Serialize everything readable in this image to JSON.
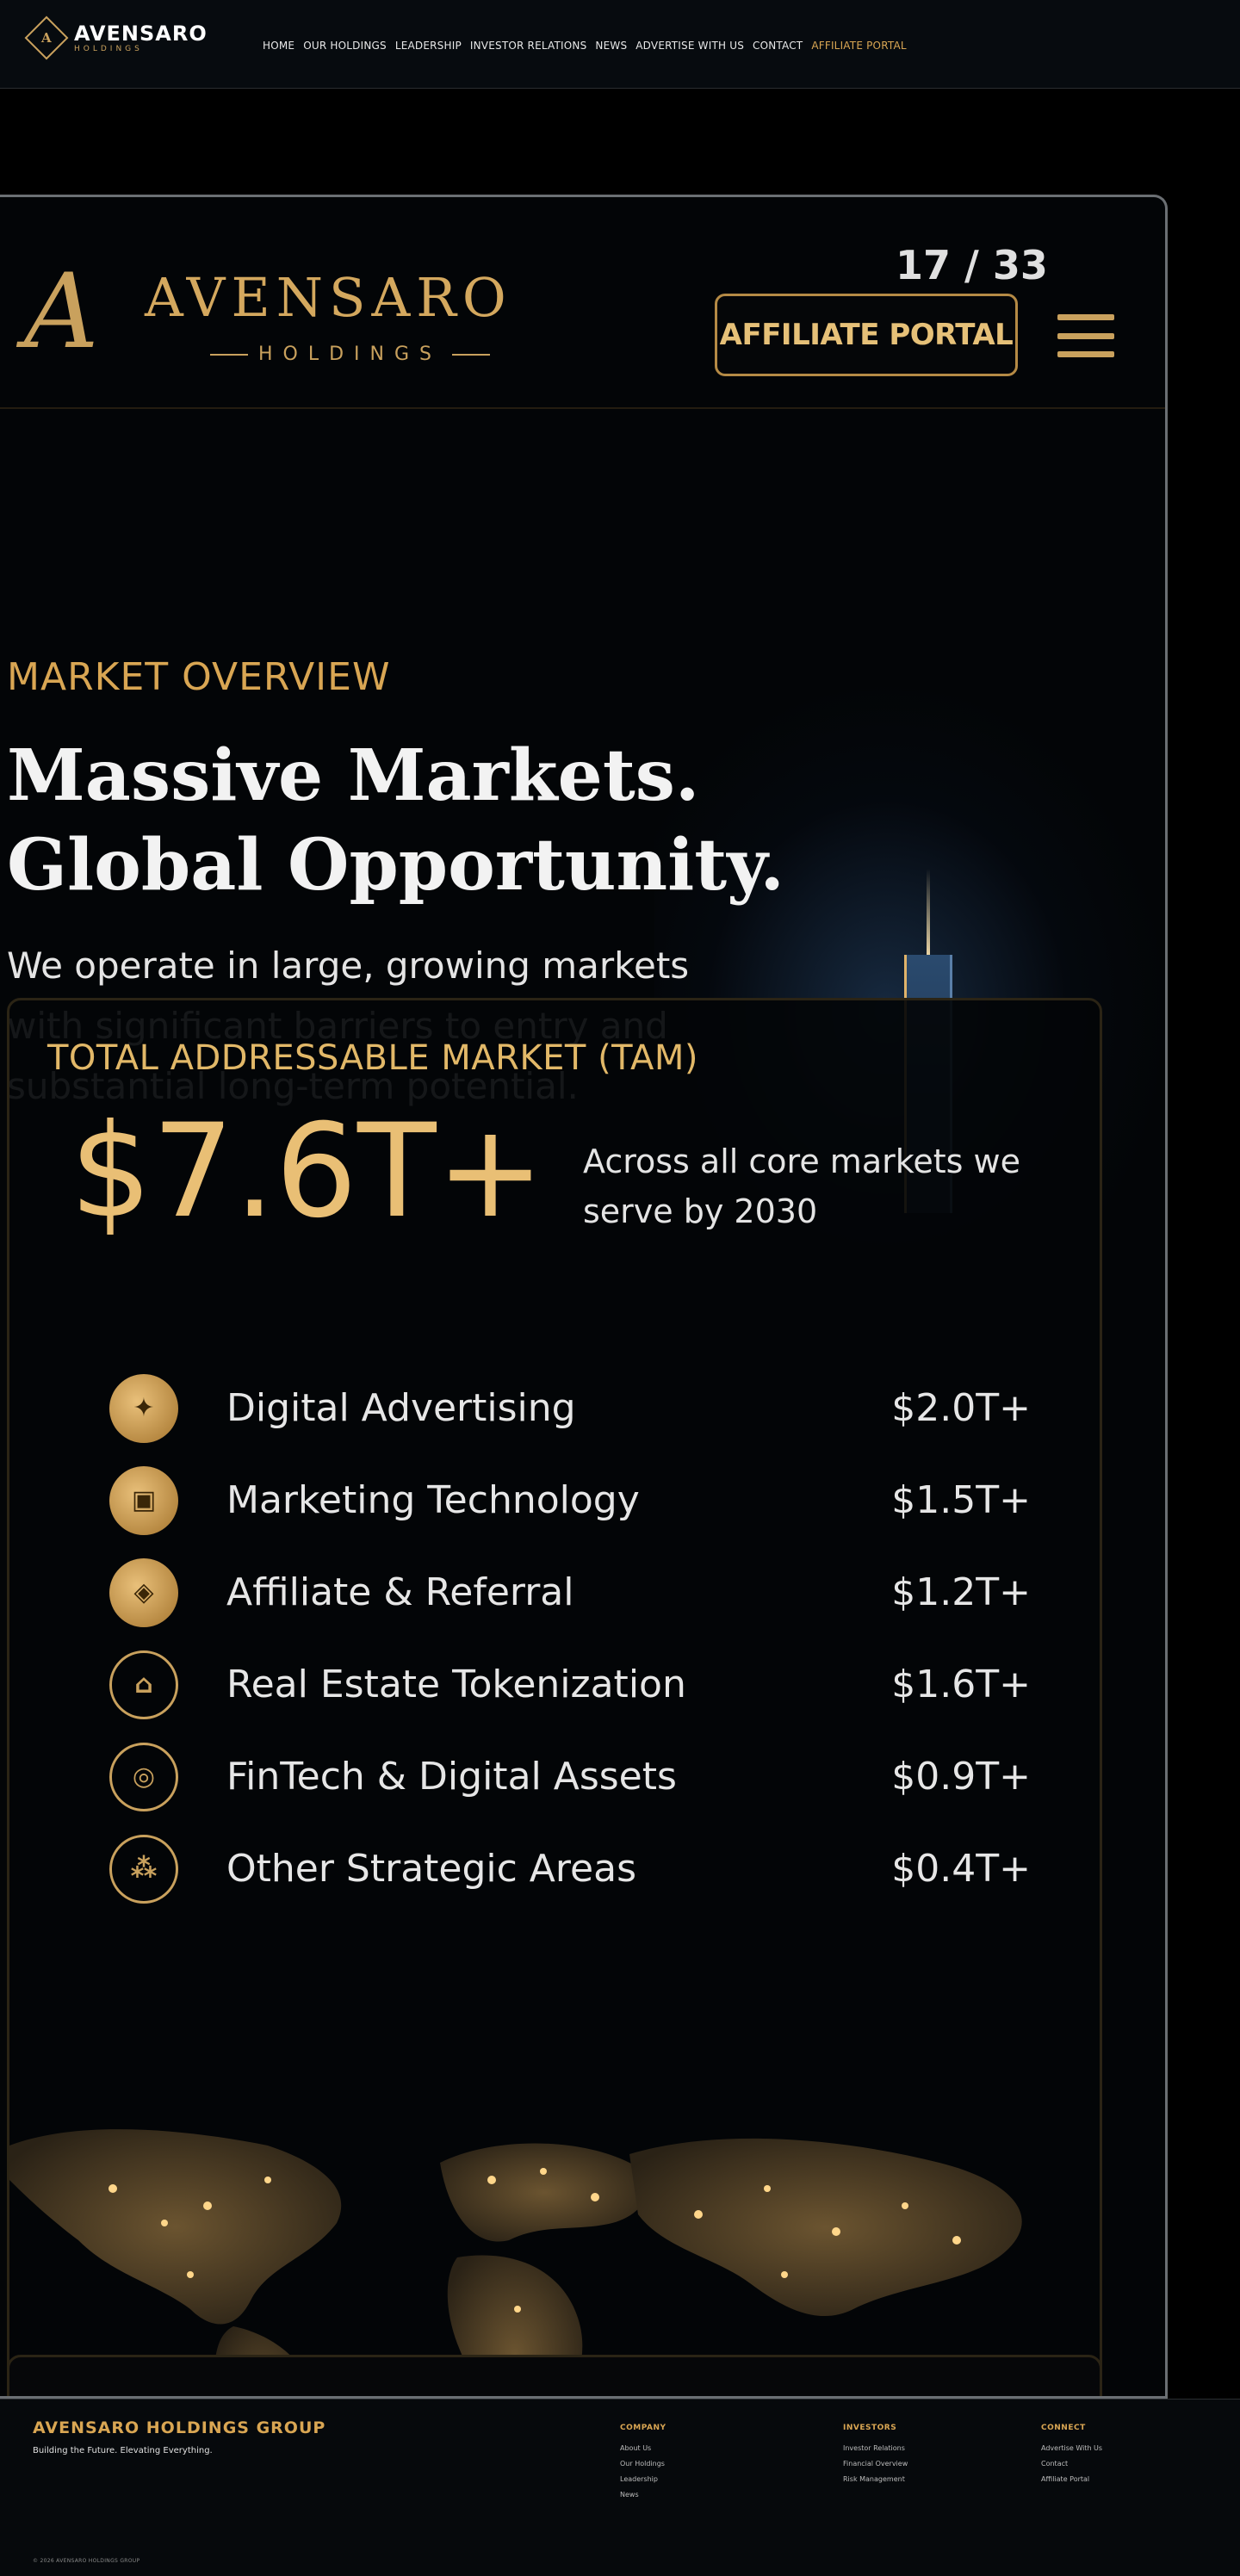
{
  "site": {
    "logo_letter": "A",
    "logo_name": "AVENSARO",
    "logo_sub": "HOLDINGS",
    "nav": [
      {
        "label": "HOME"
      },
      {
        "label": "OUR HOLDINGS"
      },
      {
        "label": "LEADERSHIP"
      },
      {
        "label": "INVESTOR RELATIONS"
      },
      {
        "label": "NEWS"
      },
      {
        "label": "ADVERTISE WITH US"
      },
      {
        "label": "CONTACT"
      },
      {
        "label": "AFFILIATE PORTAL"
      }
    ],
    "accent_color": "#d9a653"
  },
  "slide": {
    "brand_letter": "A",
    "brand_name": "AVENSARO",
    "brand_sub": "HOLDINGS",
    "page_count": "17 / 33",
    "portal_button": "AFFILIATE PORTAL",
    "eyebrow": "MARKET OVERVIEW",
    "headline_1": "Massive Markets.",
    "headline_2": "Global Opportunity.",
    "intro": "We operate in large, growing markets with significant barriers to entry and substantial long-term potential.",
    "tam": {
      "label": "TOTAL ADDRESSABLE MARKET (TAM)",
      "value": "$7.6T+",
      "description": "Across all core markets we serve by 2030"
    },
    "markets": [
      {
        "name": "Digital Advertising",
        "value": "$2.0T+",
        "icon": "badge-icon"
      },
      {
        "name": "Marketing Technology",
        "value": "$1.5T+",
        "icon": "chip-icon"
      },
      {
        "name": "Affiliate & Referral",
        "value": "$1.2T+",
        "icon": "handshake-icon"
      },
      {
        "name": "Real Estate Tokenization",
        "value": "$1.6T+",
        "icon": "building-icon"
      },
      {
        "name": "FinTech & Digital Assets",
        "value": "$0.9T+",
        "icon": "coin-icon"
      },
      {
        "name": "Other Strategic Areas",
        "value": "$0.4T+",
        "icon": "network-icon"
      }
    ]
  },
  "footer": {
    "brand": "AVENSARO HOLDINGS GROUP",
    "tagline": "Building the Future. Elevating Everything.",
    "columns": [
      {
        "title": "COMPANY",
        "links": [
          "About Us",
          "Our Holdings",
          "Leadership",
          "News"
        ]
      },
      {
        "title": "INVESTORS",
        "links": [
          "Investor Relations",
          "Financial Overview",
          "Risk Management"
        ]
      },
      {
        "title": "CONNECT",
        "links": [
          "Advertise With Us",
          "Contact",
          "Affiliate Portal"
        ]
      }
    ],
    "copyright": "© 2026 AVENSARO HOLDINGS GROUP"
  }
}
